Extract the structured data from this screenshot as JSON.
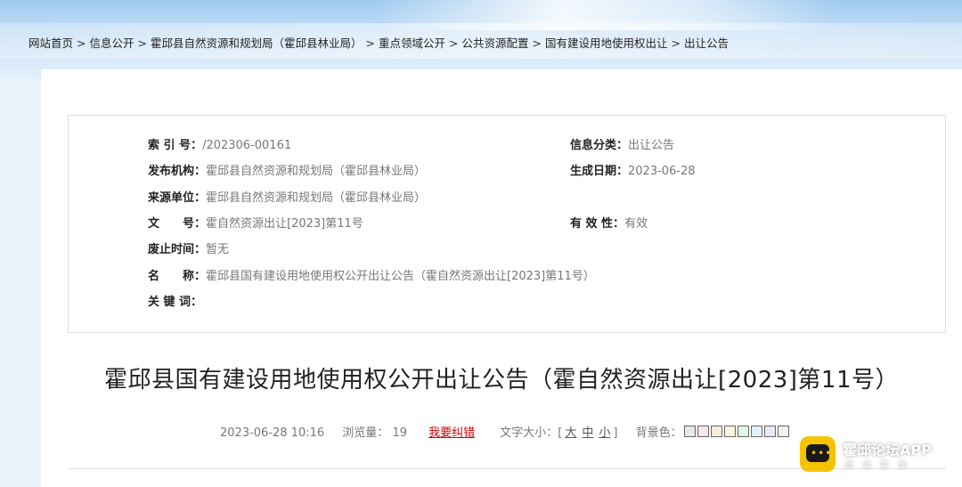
{
  "breadcrumb": [
    "网站首页",
    "信息公开",
    "霍邱县自然资源和规划局（霍邱县林业局）",
    "重点领域公开",
    "公共资源配置",
    "国有建设用地使用权出让",
    "出让公告"
  ],
  "info": {
    "index_label": "索 引 号：",
    "index_value": "/202306-00161",
    "category_label": "信息分类：",
    "category_value": "出让公告",
    "publisher_label": "发布机构：",
    "publisher_value": "霍邱县自然资源和规划局（霍邱县林业局）",
    "date_label": "生成日期：",
    "date_value": "2023-06-28",
    "source_label": "来源单位：",
    "source_value": "霍邱县自然资源和规划局（霍邱县林业局）",
    "docno_label": "文　　号：",
    "docno_value": "霍自然资源出让[2023]第11号",
    "validity_label": "有 效 性：",
    "validity_value": "有效",
    "expire_label": "废止时间：",
    "expire_value": "暂无",
    "name_label": "名　　称：",
    "name_value": "霍邱县国有建设用地使用权公开出让公告（霍自然资源出让[2023]第11号）",
    "keywords_label": "关 键 词："
  },
  "article": {
    "title": "霍邱县国有建设用地使用权公开出让公告（霍自然资源出让[2023]第11号）",
    "datetime": "2023-06-28 10:16",
    "views_label": "浏览量：",
    "views": "19",
    "error_link": "我要纠错",
    "fontsize_label": "文字大小：[",
    "fontsize_options": [
      "大",
      "中",
      "小"
    ],
    "fontsize_close": "]",
    "bgcolor_label": "背景色：",
    "bg_colors": [
      "#e8e8e8",
      "#f7e7e7",
      "#f7ecdc",
      "#f6f6dc",
      "#e5f5e5",
      "#e3f1f7",
      "#ece9f3",
      "#f1f1f1"
    ]
  },
  "watermark": {
    "app_name": "霍邱论坛APP",
    "slogan": "阅读霍邱",
    "icon_dots": "•••"
  }
}
